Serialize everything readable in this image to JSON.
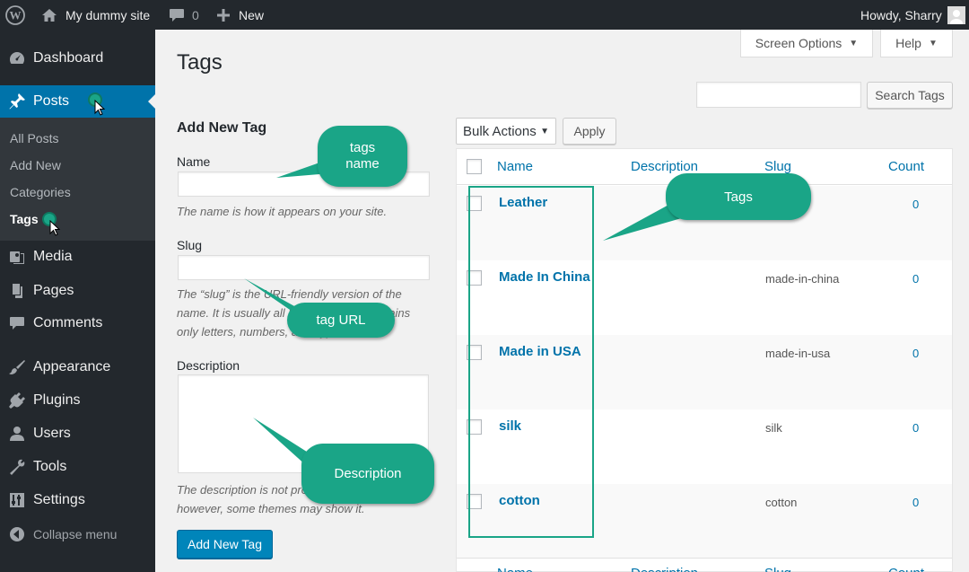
{
  "adminbar": {
    "site_name": "My dummy site",
    "comments_count": "0",
    "new_label": "New",
    "howdy": "Howdy, Sharry"
  },
  "sidebar": {
    "items": [
      {
        "label": "Dashboard",
        "icon": "dashboard-icon"
      },
      {
        "label": "Posts",
        "icon": "pin-icon"
      },
      {
        "label": "Media",
        "icon": "media-icon"
      },
      {
        "label": "Pages",
        "icon": "pages-icon"
      },
      {
        "label": "Comments",
        "icon": "comments-icon"
      },
      {
        "label": "Appearance",
        "icon": "brush-icon"
      },
      {
        "label": "Plugins",
        "icon": "plugins-icon"
      },
      {
        "label": "Users",
        "icon": "users-icon"
      },
      {
        "label": "Tools",
        "icon": "wrench-icon"
      },
      {
        "label": "Settings",
        "icon": "settings-icon"
      },
      {
        "label": "Collapse menu",
        "icon": "collapse-icon"
      }
    ],
    "submenu": [
      "All Posts",
      "Add New",
      "Categories",
      "Tags"
    ]
  },
  "screen_tabs": {
    "screen_options": "Screen Options",
    "help": "Help"
  },
  "page": {
    "title": "Tags",
    "search_button": "Search Tags",
    "search_value": ""
  },
  "form": {
    "heading": "Add New Tag",
    "name_label": "Name",
    "name_help": "The name is how it appears on your site.",
    "slug_label": "Slug",
    "slug_help": "The “slug” is the URL-friendly version of the name. It is usually all lowercase and contains only letters, numbers, and hyphens.",
    "description_label": "Description",
    "description_help": "The description is not prominent by default; however, some themes may show it.",
    "submit": "Add New Tag"
  },
  "bulk": {
    "selected": "Bulk Actions",
    "apply": "Apply"
  },
  "table": {
    "columns": [
      "Name",
      "Description",
      "Slug",
      "Count"
    ],
    "rows": [
      {
        "name": "Leather",
        "slug": "",
        "count": "0"
      },
      {
        "name": "Made In China",
        "slug": "made-in-china",
        "count": "0"
      },
      {
        "name": "Made in USA",
        "slug": "made-in-usa",
        "count": "0"
      },
      {
        "name": "silk",
        "slug": "silk",
        "count": "0"
      },
      {
        "name": "cotton",
        "slug": "cotton",
        "count": "0"
      }
    ]
  },
  "annotations": {
    "tags_name_l1": "tags",
    "tags_name_l2": "name",
    "tag_url": "tag URL",
    "tags": "Tags",
    "description": "Description"
  },
  "colors": {
    "accent": "#0073aa",
    "callout": "#1aa587",
    "sidebar_bg": "#23282d"
  }
}
